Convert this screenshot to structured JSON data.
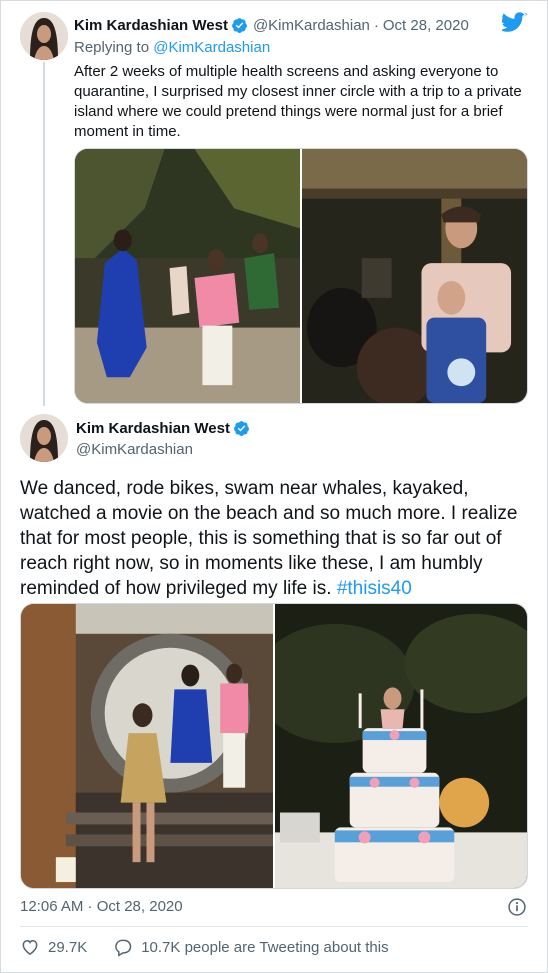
{
  "reply_tweet": {
    "author_name": "Kim Kardashian West",
    "author_handle": "@KimKardashian",
    "separator": "·",
    "date": "Oct 28, 2020",
    "replying_prefix": "Replying to",
    "replying_to": "@KimKardashian",
    "text": "After 2 weeks of multiple health screens and asking everyone to quarantine, I surprised my closest inner circle with a trip to a private island where we could pretend things were normal just for a brief moment in time."
  },
  "main_tweet": {
    "author_name": "Kim Kardashian West",
    "author_handle": "@KimKardashian",
    "text": "We danced, rode bikes, swam near whales, kayaked, watched a movie on the beach and so much more. I realize that for most people, this is something that is so far out of reach right now, so in moments like these, I am humbly reminded of how privileged my life is. ",
    "hashtag": "#thisis40",
    "timestamp": "12:06 AM · Oct 28, 2020",
    "likes": "29.7K",
    "tweeting_about": "10.7K people are Tweeting about this"
  },
  "icons": {
    "brand": "twitter-bird-icon",
    "verified": "verified-badge-icon",
    "info": "info-icon",
    "like": "heart-icon",
    "reply": "speech-bubble-icon"
  },
  "colors": {
    "accent": "#1d9bf0",
    "text": "#0f1419",
    "muted": "#536471",
    "border": "#cfd9de"
  }
}
